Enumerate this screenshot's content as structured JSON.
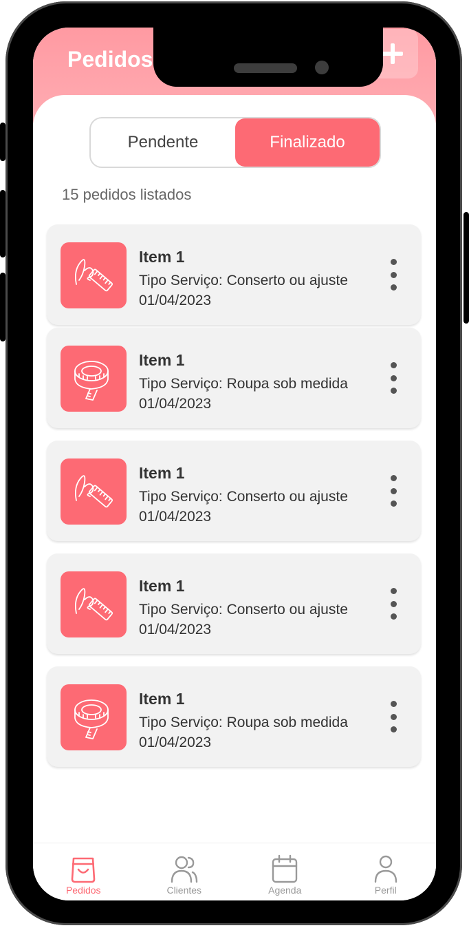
{
  "header": {
    "title": "Pedidos"
  },
  "tabs": [
    {
      "label": "Pendente",
      "active": false
    },
    {
      "label": "Finalizado",
      "active": true
    }
  ],
  "summary": {
    "count_text": "15 pedidos listados"
  },
  "orders": [
    {
      "name": "Item 1",
      "service": "Tipo Serviço: Conserto ou ajuste",
      "date": "01/04/2023",
      "icon": "needle-thread-icon"
    },
    {
      "name": "Item 1",
      "service": "Tipo Serviço: Roupa sob medida",
      "date": "01/04/2023",
      "icon": "measuring-tape-icon"
    },
    {
      "name": "Item 1",
      "service": "Tipo Serviço: Conserto ou ajuste",
      "date": "01/04/2023",
      "icon": "needle-thread-icon"
    },
    {
      "name": "Item 1",
      "service": "Tipo Serviço: Conserto ou ajuste",
      "date": "01/04/2023",
      "icon": "needle-thread-icon"
    },
    {
      "name": "Item 1",
      "service": "Tipo Serviço: Roupa sob medida",
      "date": "01/04/2023",
      "icon": "measuring-tape-icon"
    }
  ],
  "bottom_nav": [
    {
      "label": "Pedidos",
      "icon": "shopping-bag-icon",
      "active": true
    },
    {
      "label": "Clientes",
      "icon": "users-icon",
      "active": false
    },
    {
      "label": "Agenda",
      "icon": "calendar-icon",
      "active": false
    },
    {
      "label": "Perfil",
      "icon": "user-icon",
      "active": false
    }
  ],
  "colors": {
    "accent": "#fd6a74",
    "header": "#ff9aa2",
    "card": "#f2f2f2"
  }
}
